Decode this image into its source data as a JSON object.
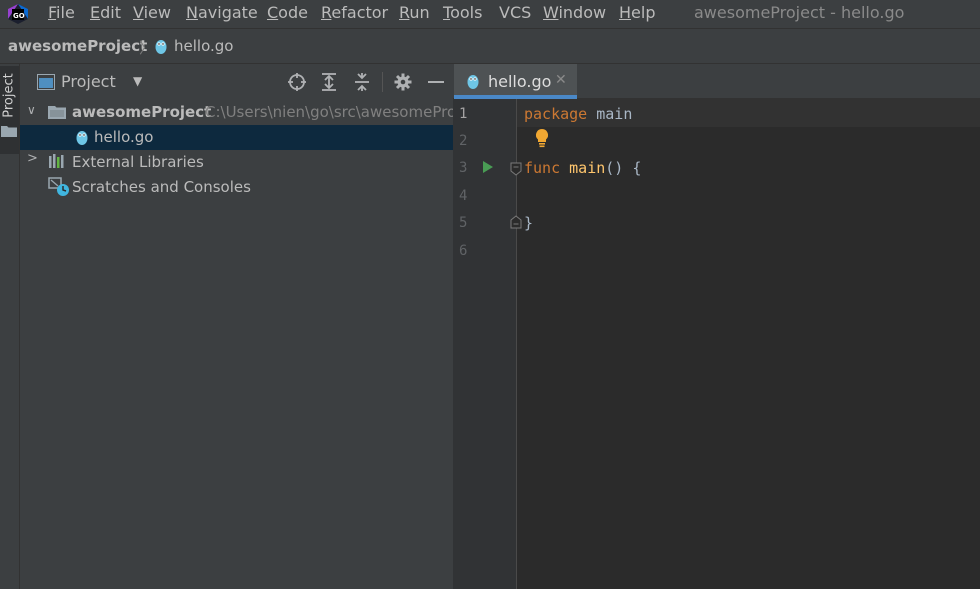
{
  "menu": {
    "items": [
      {
        "label": "File",
        "mnemonic": "F",
        "rest": "ile"
      },
      {
        "label": "Edit",
        "mnemonic": "E",
        "rest": "dit"
      },
      {
        "label": "View",
        "mnemonic": "V",
        "rest": "iew"
      },
      {
        "label": "Navigate",
        "mnemonic": "N",
        "rest": "avigate"
      },
      {
        "label": "Code",
        "mnemonic": "C",
        "rest": "ode"
      },
      {
        "label": "Refactor",
        "mnemonic": "R",
        "rest": "efactor"
      },
      {
        "label": "Run",
        "mnemonic": "R",
        "rest": "un"
      },
      {
        "label": "Tools",
        "mnemonic": "T",
        "rest": "ools"
      },
      {
        "label": "VCS",
        "mnemonic": "",
        "rest": "VCS"
      },
      {
        "label": "Window",
        "mnemonic": "W",
        "rest": "indow"
      },
      {
        "label": "Help",
        "mnemonic": "H",
        "rest": "elp"
      }
    ],
    "window_title": "awesomeProject - hello.go"
  },
  "breadcrumb": {
    "project": "awesomeProject",
    "file": "hello.go"
  },
  "tool_stripe": {
    "project_label": "Project"
  },
  "project_panel": {
    "title": "Project",
    "tree": {
      "root_name": "awesomeProject",
      "root_path": "C:\\Users\\nien\\go\\src\\awesomeProject",
      "file": "hello.go",
      "external_libraries": "External Libraries",
      "scratches": "Scratches and Consoles"
    }
  },
  "editor": {
    "tab_label": "hello.go",
    "line_numbers": [
      "1",
      "2",
      "3",
      "4",
      "5",
      "6"
    ],
    "code": {
      "l1_kw": "package",
      "l1_ident": "main",
      "l3_kw": "func",
      "l3_fn": "main",
      "l3_rest": "() {",
      "l5": "}"
    }
  },
  "colors": {
    "accent": "#4a88c7",
    "keyword": "#cc7832",
    "function": "#ffc66d",
    "run_green": "#499c54"
  }
}
